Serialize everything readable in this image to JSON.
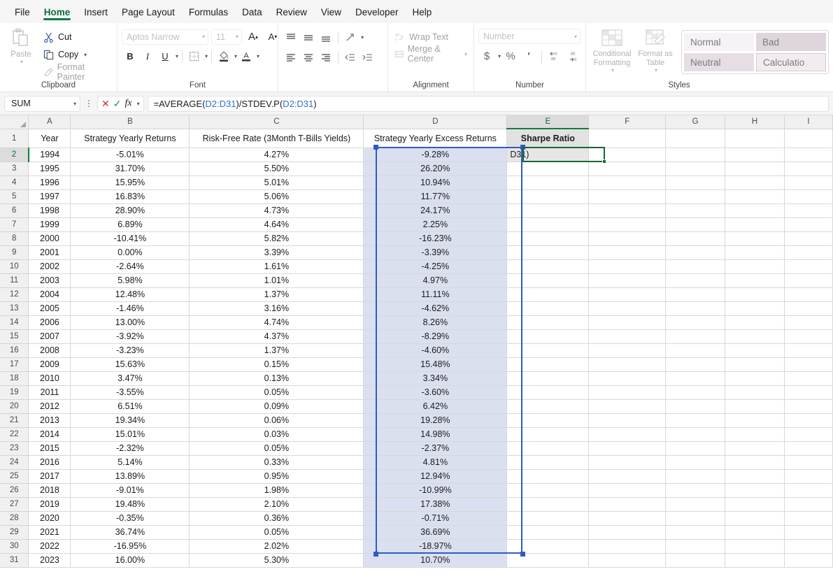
{
  "ribbon": {
    "tabs": [
      {
        "label": "File",
        "active": false
      },
      {
        "label": "Home",
        "active": true
      },
      {
        "label": "Insert",
        "active": false
      },
      {
        "label": "Page Layout",
        "active": false
      },
      {
        "label": "Formulas",
        "active": false
      },
      {
        "label": "Data",
        "active": false
      },
      {
        "label": "Review",
        "active": false
      },
      {
        "label": "View",
        "active": false
      },
      {
        "label": "Developer",
        "active": false
      },
      {
        "label": "Help",
        "active": false
      }
    ],
    "clipboard": {
      "group_label": "Clipboard",
      "paste": "Paste",
      "cut": "Cut",
      "copy": "Copy",
      "format_painter": "Format Painter"
    },
    "font": {
      "group_label": "Font",
      "font_name": "Aptos Narrow",
      "font_size": "11",
      "bold": "B",
      "italic": "I",
      "underline": "U"
    },
    "alignment": {
      "group_label": "Alignment",
      "wrap_text": "Wrap Text",
      "merge_center": "Merge & Center"
    },
    "number": {
      "group_label": "Number",
      "format": "Number",
      "currency": "$",
      "percent": "%",
      "comma": "′"
    },
    "styles": {
      "group_label": "Styles",
      "conditional_formatting": "Conditional\nFormatting",
      "conditional_formatting_l1": "Conditional",
      "conditional_formatting_l2": "Formatting",
      "format_as_table_l1": "Format as",
      "format_as_table_l2": "Table",
      "gallery": [
        "Normal",
        "Bad",
        "Neutral",
        "Calculatio"
      ]
    }
  },
  "formula_bar": {
    "name_box": "SUM",
    "cancel_icon": "cancel-x-icon",
    "enter_icon": "confirm-check-icon",
    "function_icon": "fx-insert-function-icon",
    "formula_prefix": "=AVERAGE(",
    "formula_ref1": "D2:D31",
    "formula_mid": ")/STDEV.P(",
    "formula_ref2": "D2:D31",
    "formula_suffix": ")"
  },
  "sheet": {
    "column_letters": [
      "A",
      "B",
      "C",
      "D",
      "E",
      "F",
      "G",
      "H",
      "I"
    ],
    "selected_column": "E",
    "selected_row": "2",
    "headers": {
      "a": "Year",
      "b": "Strategy Yearly Returns",
      "c": "Risk-Free Rate (3Month T-Bills Yields)",
      "d": "Strategy Yearly Excess Returns",
      "e": "Sharpe Ratio"
    },
    "editing_cell_text": "D31)",
    "range_selection": "D2:D31",
    "rows": [
      {
        "n": "2",
        "year": "1994",
        "ret": "-5.01%",
        "rf": "4.27%",
        "ex": "-9.28%"
      },
      {
        "n": "3",
        "year": "1995",
        "ret": "31.70%",
        "rf": "5.50%",
        "ex": "26.20%"
      },
      {
        "n": "4",
        "year": "1996",
        "ret": "15.95%",
        "rf": "5.01%",
        "ex": "10.94%"
      },
      {
        "n": "5",
        "year": "1997",
        "ret": "16.83%",
        "rf": "5.06%",
        "ex": "11.77%"
      },
      {
        "n": "6",
        "year": "1998",
        "ret": "28.90%",
        "rf": "4.73%",
        "ex": "24.17%"
      },
      {
        "n": "7",
        "year": "1999",
        "ret": "6.89%",
        "rf": "4.64%",
        "ex": "2.25%"
      },
      {
        "n": "8",
        "year": "2000",
        "ret": "-10.41%",
        "rf": "5.82%",
        "ex": "-16.23%"
      },
      {
        "n": "9",
        "year": "2001",
        "ret": "0.00%",
        "rf": "3.39%",
        "ex": "-3.39%"
      },
      {
        "n": "10",
        "year": "2002",
        "ret": "-2.64%",
        "rf": "1.61%",
        "ex": "-4.25%"
      },
      {
        "n": "11",
        "year": "2003",
        "ret": "5.98%",
        "rf": "1.01%",
        "ex": "4.97%"
      },
      {
        "n": "12",
        "year": "2004",
        "ret": "12.48%",
        "rf": "1.37%",
        "ex": "11.11%"
      },
      {
        "n": "13",
        "year": "2005",
        "ret": "-1.46%",
        "rf": "3.16%",
        "ex": "-4.62%"
      },
      {
        "n": "14",
        "year": "2006",
        "ret": "13.00%",
        "rf": "4.74%",
        "ex": "8.26%"
      },
      {
        "n": "15",
        "year": "2007",
        "ret": "-3.92%",
        "rf": "4.37%",
        "ex": "-8.29%"
      },
      {
        "n": "16",
        "year": "2008",
        "ret": "-3.23%",
        "rf": "1.37%",
        "ex": "-4.60%"
      },
      {
        "n": "17",
        "year": "2009",
        "ret": "15.63%",
        "rf": "0.15%",
        "ex": "15.48%"
      },
      {
        "n": "18",
        "year": "2010",
        "ret": "3.47%",
        "rf": "0.13%",
        "ex": "3.34%"
      },
      {
        "n": "19",
        "year": "2011",
        "ret": "-3.55%",
        "rf": "0.05%",
        "ex": "-3.60%"
      },
      {
        "n": "20",
        "year": "2012",
        "ret": "6.51%",
        "rf": "0.09%",
        "ex": "6.42%"
      },
      {
        "n": "21",
        "year": "2013",
        "ret": "19.34%",
        "rf": "0.06%",
        "ex": "19.28%"
      },
      {
        "n": "22",
        "year": "2014",
        "ret": "15.01%",
        "rf": "0.03%",
        "ex": "14.98%"
      },
      {
        "n": "23",
        "year": "2015",
        "ret": "-2.32%",
        "rf": "0.05%",
        "ex": "-2.37%"
      },
      {
        "n": "24",
        "year": "2016",
        "ret": "5.14%",
        "rf": "0.33%",
        "ex": "4.81%"
      },
      {
        "n": "25",
        "year": "2017",
        "ret": "13.89%",
        "rf": "0.95%",
        "ex": "12.94%"
      },
      {
        "n": "26",
        "year": "2018",
        "ret": "-9.01%",
        "rf": "1.98%",
        "ex": "-10.99%"
      },
      {
        "n": "27",
        "year": "2019",
        "ret": "19.48%",
        "rf": "2.10%",
        "ex": "17.38%"
      },
      {
        "n": "28",
        "year": "2020",
        "ret": "-0.35%",
        "rf": "0.36%",
        "ex": "-0.71%"
      },
      {
        "n": "29",
        "year": "2021",
        "ret": "36.74%",
        "rf": "0.05%",
        "ex": "36.69%"
      },
      {
        "n": "30",
        "year": "2022",
        "ret": "-16.95%",
        "rf": "2.02%",
        "ex": "-18.97%"
      },
      {
        "n": "31",
        "year": "2023",
        "ret": "16.00%",
        "rf": "5.30%",
        "ex": "10.70%"
      }
    ]
  },
  "colors": {
    "excel_green": "#107c41",
    "range_border": "#2f5bc4",
    "range_fill": "#dae0f0",
    "active_border": "#14683a",
    "formula_ref": "#2f6fd0"
  }
}
